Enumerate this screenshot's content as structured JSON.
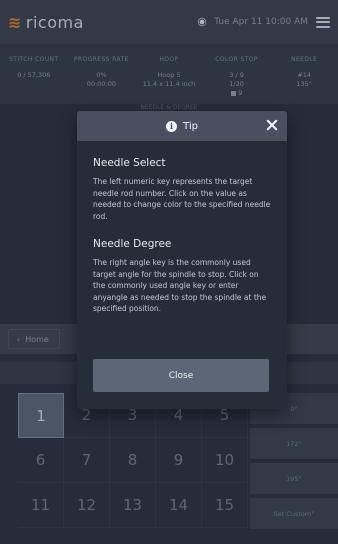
{
  "header": {
    "logo_mark": "≋",
    "brand": "ricoma",
    "datetime": "Tue Apr 11  10:00 AM"
  },
  "stats": [
    {
      "label": "STITCH COUNT",
      "lines": [
        "0 / 57,306"
      ]
    },
    {
      "label": "PROGRESS RATE",
      "lines": [
        "0%",
        "00:00:00"
      ]
    },
    {
      "label": "HOOP",
      "lines": [
        "Hoop 5",
        "11.4 x 11.4 inch"
      ]
    },
    {
      "label": "COLOR STOP",
      "lines": [
        "3 / 9",
        "1/20",
        "9"
      ]
    },
    {
      "label": "NEEDLE",
      "lines": [
        "#14",
        "135°"
      ]
    }
  ],
  "subline": "NEEDLE & DEGREE",
  "nav": {
    "home_label": "Home"
  },
  "keypad": [
    "1",
    "2",
    "3",
    "4",
    "5",
    "6",
    "7",
    "8",
    "9",
    "10",
    "11",
    "12",
    "13",
    "14",
    "15"
  ],
  "angles": [
    "0°",
    "172°",
    "195°",
    "Set Custom°"
  ],
  "modal": {
    "title": "Tip",
    "sections": [
      {
        "title": "Needle Select",
        "text": "The left numeric key represents the target needle rod number. Click on the value as needed to change color to the specified needle rod."
      },
      {
        "title": "Needle Degree",
        "text": "The right angle key is the commonly used target angle for the spindle to stop. Click on the commonly used angle key or enter anyangle as needed to stop the spindle at the specified position."
      }
    ],
    "close_label": "Close"
  },
  "colors": {
    "brand_orange": "#e07b22",
    "modal_bg": "#252d39",
    "modal_header": "#485060",
    "button_bg": "#5c6677"
  }
}
